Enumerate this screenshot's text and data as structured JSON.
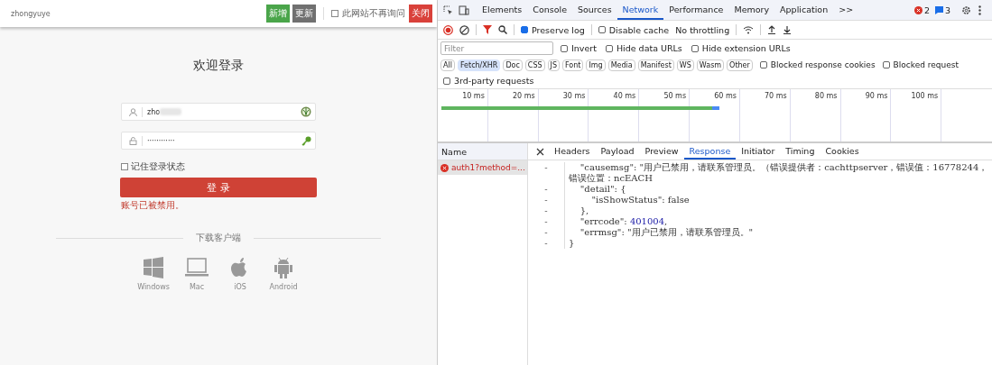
{
  "login_page": {
    "header": {
      "user": "zhongyuye",
      "buttons": [
        {
          "label": "新增",
          "kind": "add"
        },
        {
          "label": "更新",
          "kind": "update"
        }
      ],
      "dont_ask": {
        "label": "此网站不再询问",
        "checked": false
      },
      "close": "关闭"
    },
    "title": "欢迎登录",
    "username": {
      "value": "zho"
    },
    "password": {
      "value": "············"
    },
    "remember": {
      "label": "记住登录状态",
      "checked": false
    },
    "login_button": "登 录",
    "error": "账号已被禁用。",
    "download_title": "下载客户端",
    "clients": [
      {
        "label": "Windows",
        "kind": "windows"
      },
      {
        "label": "Mac",
        "kind": "mac"
      },
      {
        "label": "iOS",
        "kind": "ios"
      },
      {
        "label": "Android",
        "kind": "android"
      }
    ]
  },
  "devtools": {
    "tabs": [
      {
        "label": "Elements",
        "selected": false
      },
      {
        "label": "Console",
        "selected": false
      },
      {
        "label": "Sources",
        "selected": false
      },
      {
        "label": "Network",
        "selected": true
      },
      {
        "label": "Performance",
        "selected": false
      },
      {
        "label": "Memory",
        "selected": false
      },
      {
        "label": "Application",
        "selected": false
      }
    ],
    "more": ">>",
    "errors": "2",
    "messages": "3",
    "preserve_log": {
      "label": "Preserve log",
      "checked": true
    },
    "disable_cache": {
      "label": "Disable cache",
      "checked": false
    },
    "throttling": "No throttling",
    "filter": {
      "placeholder": "Filter"
    },
    "filter_options": [
      {
        "label": "Invert",
        "checked": false
      },
      {
        "label": "Hide data URLs",
        "checked": false
      },
      {
        "label": "Hide extension URLs",
        "checked": false
      }
    ],
    "types": [
      {
        "label": "All",
        "selected": false
      },
      {
        "label": "Fetch/XHR",
        "selected": true
      },
      {
        "label": "Doc",
        "selected": false
      },
      {
        "label": "CSS",
        "selected": false
      },
      {
        "label": "JS",
        "selected": false
      },
      {
        "label": "Font",
        "selected": false
      },
      {
        "label": "Img",
        "selected": false
      },
      {
        "label": "Media",
        "selected": false
      },
      {
        "label": "Manifest",
        "selected": false
      },
      {
        "label": "WS",
        "selected": false
      },
      {
        "label": "Wasm",
        "selected": false
      },
      {
        "label": "Other",
        "selected": false
      }
    ],
    "type_options": [
      {
        "label": "Blocked response cookies",
        "checked": false
      },
      {
        "label": "Blocked request",
        "checked": false
      }
    ],
    "third_party": {
      "label": "3rd-party requests",
      "checked": false
    },
    "timeline_ticks": [
      "10 ms",
      "20 ms",
      "30 ms",
      "40 ms",
      "50 ms",
      "60 ms",
      "70 ms",
      "80 ms",
      "90 ms",
      "100 ms"
    ],
    "name_header": "Name",
    "requests": [
      {
        "name": "auth1?method=...",
        "selected": true,
        "failed": true
      }
    ],
    "detail_tabs": [
      {
        "label": "Headers",
        "selected": false
      },
      {
        "label": "Payload",
        "selected": false
      },
      {
        "label": "Preview",
        "selected": false
      },
      {
        "label": "Response",
        "selected": true
      },
      {
        "label": "Initiator",
        "selected": false
      },
      {
        "label": "Timing",
        "selected": false
      },
      {
        "label": "Cookies",
        "selected": false
      }
    ],
    "response_lines": [
      {
        "marker": "-",
        "parts": [
          {
            "text": "    \"causemsg\": \"用户已禁用，请联系管理员。（错误提供者：cachttpserver，错误值：16778244，错误位置：ncEACH",
            "kind": "plain"
          }
        ]
      },
      {
        "marker": "-",
        "parts": [
          {
            "text": "    \"detail\": {",
            "kind": "plain"
          }
        ]
      },
      {
        "marker": "-",
        "parts": [
          {
            "text": "        \"isShowStatus\": false",
            "kind": "plain"
          }
        ]
      },
      {
        "marker": "-",
        "parts": [
          {
            "text": "    },",
            "kind": "plain"
          }
        ]
      },
      {
        "marker": "-",
        "parts": [
          {
            "text": "    \"errcode\": ",
            "kind": "plain"
          },
          {
            "text": "401004",
            "kind": "number"
          },
          {
            "text": ",",
            "kind": "plain"
          }
        ]
      },
      {
        "marker": "-",
        "parts": [
          {
            "text": "    \"errmsg\": \"用户已禁用，请联系管理员。\"",
            "kind": "plain"
          }
        ]
      },
      {
        "marker": "-",
        "parts": [
          {
            "text": "}",
            "kind": "plain"
          }
        ]
      }
    ]
  }
}
